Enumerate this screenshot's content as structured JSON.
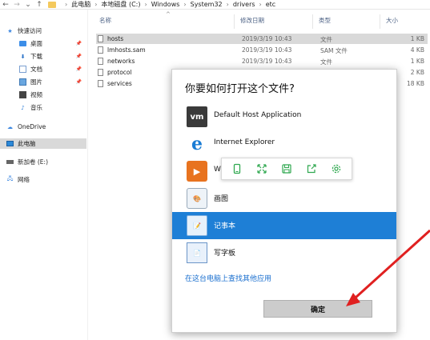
{
  "address": {
    "crumbs": [
      "此电脑",
      "本地磁盘 (C:)",
      "Windows",
      "System32",
      "drivers",
      "etc"
    ]
  },
  "sidebar": {
    "items": [
      {
        "label": "快速访问",
        "icon": "star-icon"
      },
      {
        "label": "桌面",
        "icon": "desktop-icon",
        "pinned": true
      },
      {
        "label": "下载",
        "icon": "download-icon",
        "pinned": true
      },
      {
        "label": "文档",
        "icon": "documents-icon",
        "pinned": true
      },
      {
        "label": "图片",
        "icon": "pictures-icon",
        "pinned": true
      },
      {
        "label": "视频",
        "icon": "videos-icon"
      },
      {
        "label": "音乐",
        "icon": "music-icon"
      },
      {
        "label": "OneDrive",
        "icon": "cloud-icon"
      },
      {
        "label": "此电脑",
        "icon": "computer-icon",
        "selected": true
      },
      {
        "label": "新加卷 (E:)",
        "icon": "drive-icon"
      },
      {
        "label": "网络",
        "icon": "network-icon"
      }
    ]
  },
  "filelist": {
    "columns": {
      "name": "名称",
      "date": "修改日期",
      "type": "类型",
      "size": "大小"
    },
    "rows": [
      {
        "name": "hosts",
        "date": "2019/3/19 10:43",
        "type": "文件",
        "size": "1 KB",
        "selected": true
      },
      {
        "name": "lmhosts.sam",
        "date": "2019/3/19 10:43",
        "type": "SAM 文件",
        "size": "4 KB"
      },
      {
        "name": "networks",
        "date": "2019/3/19 10:43",
        "type": "文件",
        "size": "1 KB"
      },
      {
        "name": "protocol",
        "date": "",
        "type": "",
        "size": "2 KB"
      },
      {
        "name": "services",
        "date": "",
        "type": "",
        "size": "18 KB"
      }
    ]
  },
  "dialog": {
    "title": "你要如何打开这个文件?",
    "apps": [
      {
        "label": "Default Host Application",
        "icon": "vmware-icon",
        "glyph": "vm"
      },
      {
        "label": "Internet Explorer",
        "icon": "internet-explorer-icon",
        "glyph": "e"
      },
      {
        "label": "W",
        "icon": "media-player-icon",
        "glyph": "▶"
      },
      {
        "label": "画图",
        "icon": "paint-icon",
        "glyph": "🎨"
      },
      {
        "label": "记事本",
        "icon": "notepad-icon",
        "glyph": "📝",
        "selected": true
      },
      {
        "label": "写字板",
        "icon": "wordpad-icon",
        "glyph": "📄"
      }
    ],
    "more_link": "在这台电脑上查找其他应用",
    "ok_label": "确定"
  },
  "floating_toolbar": {
    "buttons": [
      "phone-icon",
      "expand-icon",
      "save-icon",
      "share-icon",
      "settings-icon"
    ],
    "accent": "#2fa84f"
  },
  "colors": {
    "selection_blue": "#1e7fd6",
    "link_blue": "#1a6fcf",
    "arrow_red": "#e02020"
  }
}
